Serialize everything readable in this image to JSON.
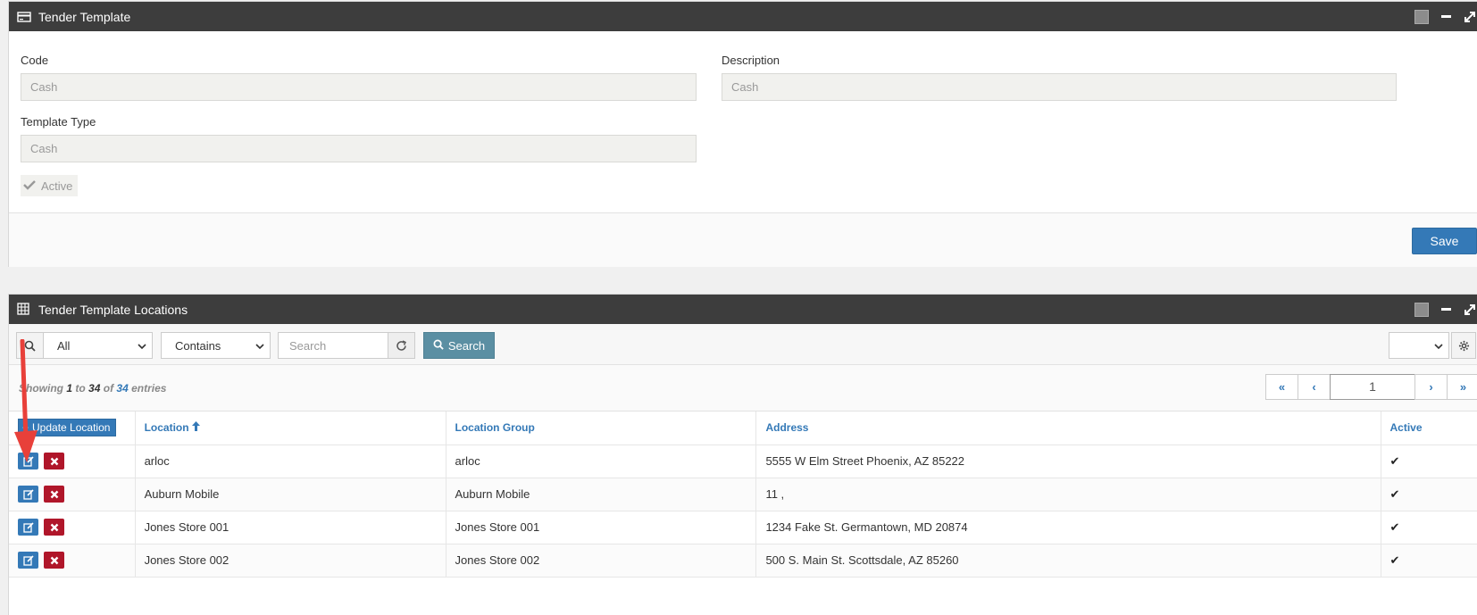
{
  "form_panel": {
    "title": "Tender Template",
    "code_label": "Code",
    "code_value": "Cash",
    "description_label": "Description",
    "description_value": "Cash",
    "template_type_label": "Template Type",
    "template_type_value": "Cash",
    "active_label": "Active",
    "save_label": "Save"
  },
  "locations_panel": {
    "title": "Tender Template Locations",
    "filter_field": "All",
    "filter_operator": "Contains",
    "search_placeholder": "Search",
    "search_button": "Search",
    "entries": {
      "prefix": "Showing",
      "from": "1",
      "to_word": "to",
      "to": "34",
      "of_word": "of",
      "total": "34",
      "suffix": "entries"
    },
    "pager": {
      "first": "«",
      "prev": "‹",
      "page": "1",
      "next": "›",
      "last": "»"
    },
    "update_button": "Update Location",
    "columns": [
      "Location",
      "Location Group",
      "Address",
      "Active"
    ],
    "rows": [
      {
        "location": "arloc",
        "group": "arloc",
        "address": "5555 W Elm Street Phoenix, AZ 85222",
        "active": "✔"
      },
      {
        "location": "Auburn Mobile",
        "group": "Auburn Mobile",
        "address": "11 ,",
        "active": "✔"
      },
      {
        "location": "Jones Store 001",
        "group": "Jones Store 001",
        "address": "1234 Fake St. Germantown, MD 20874",
        "active": "✔"
      },
      {
        "location": "Jones Store 002",
        "group": "Jones Store 002",
        "address": "500 S. Main St. Scottsdale, AZ 85260",
        "active": "✔"
      }
    ]
  },
  "colors": {
    "header_bg": "#3d3d3d",
    "primary": "#3479b7",
    "danger": "#b0162a",
    "search_btn": "#5b8fa3",
    "annotation_arrow": "#e8403a"
  },
  "icons": [
    "card-icon",
    "grid-icon",
    "search-icon",
    "refresh-icon",
    "gear-icon",
    "edit-icon",
    "delete-icon",
    "sort-up-icon",
    "check-icon"
  ]
}
